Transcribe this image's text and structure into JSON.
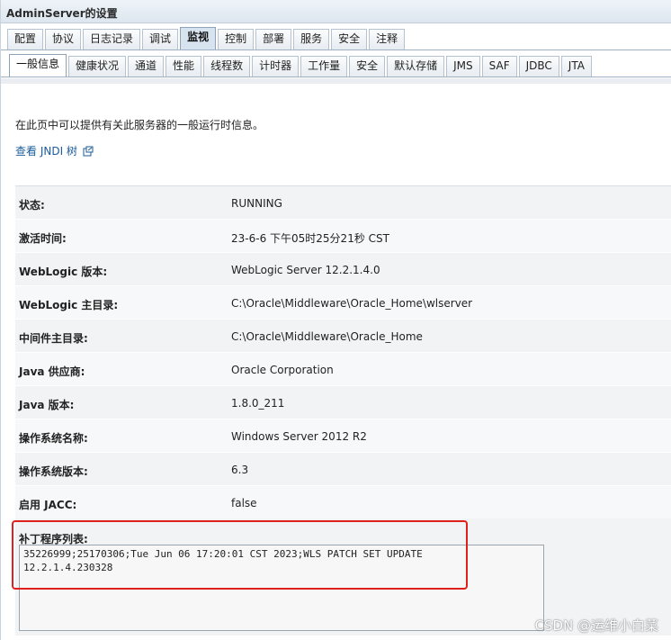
{
  "window": {
    "title": "AdminServer的设置"
  },
  "primary_tabs": [
    {
      "label": "配置"
    },
    {
      "label": "协议"
    },
    {
      "label": "日志记录"
    },
    {
      "label": "调试"
    },
    {
      "label": "监视"
    },
    {
      "label": "控制"
    },
    {
      "label": "部署"
    },
    {
      "label": "服务"
    },
    {
      "label": "安全"
    },
    {
      "label": "注释"
    }
  ],
  "primary_active": "监视",
  "secondary_tabs": [
    {
      "label": "一般信息"
    },
    {
      "label": "健康状况"
    },
    {
      "label": "通道"
    },
    {
      "label": "性能"
    },
    {
      "label": "线程数"
    },
    {
      "label": "计时器"
    },
    {
      "label": "工作量"
    },
    {
      "label": "安全"
    },
    {
      "label": "默认存储"
    },
    {
      "label": "JMS"
    },
    {
      "label": "SAF"
    },
    {
      "label": "JDBC"
    },
    {
      "label": "JTA"
    }
  ],
  "secondary_active": "一般信息",
  "intro": "在此页中可以提供有关此服务器的一般运行时信息。",
  "jndi_link": "查看 JNDI 树",
  "properties": [
    {
      "label": "状态:",
      "value": "RUNNING"
    },
    {
      "label": "激活时间:",
      "value": "23-6-6 下午05时25分21秒 CST"
    },
    {
      "label": "WebLogic 版本:",
      "value": "WebLogic Server 12.2.1.4.0"
    },
    {
      "label": "WebLogic 主目录:",
      "value": "C:\\Oracle\\Middleware\\Oracle_Home\\wlserver"
    },
    {
      "label": "中间件主目录:",
      "value": "C:\\Oracle\\Middleware\\Oracle_Home"
    },
    {
      "label": "Java 供应商:",
      "value": "Oracle Corporation"
    },
    {
      "label": "Java 版本:",
      "value": "1.8.0_211"
    },
    {
      "label": "操作系统名称:",
      "value": "Windows Server 2012 R2"
    },
    {
      "label": "操作系统版本:",
      "value": "6.3"
    },
    {
      "label": "启用 JACC:",
      "value": "false"
    }
  ],
  "patch": {
    "label": "补丁程序列表:",
    "value": "35226999;25170306;Tue Jun 06 17:20:01 CST 2023;WLS PATCH SET UPDATE\n12.2.1.4.230328"
  },
  "watermark": "CSDN @运维小白菜",
  "colors": {
    "link": "#1a5b9a",
    "highlight_outline": "#e0201c",
    "tab_active": "#d7e3ef"
  }
}
